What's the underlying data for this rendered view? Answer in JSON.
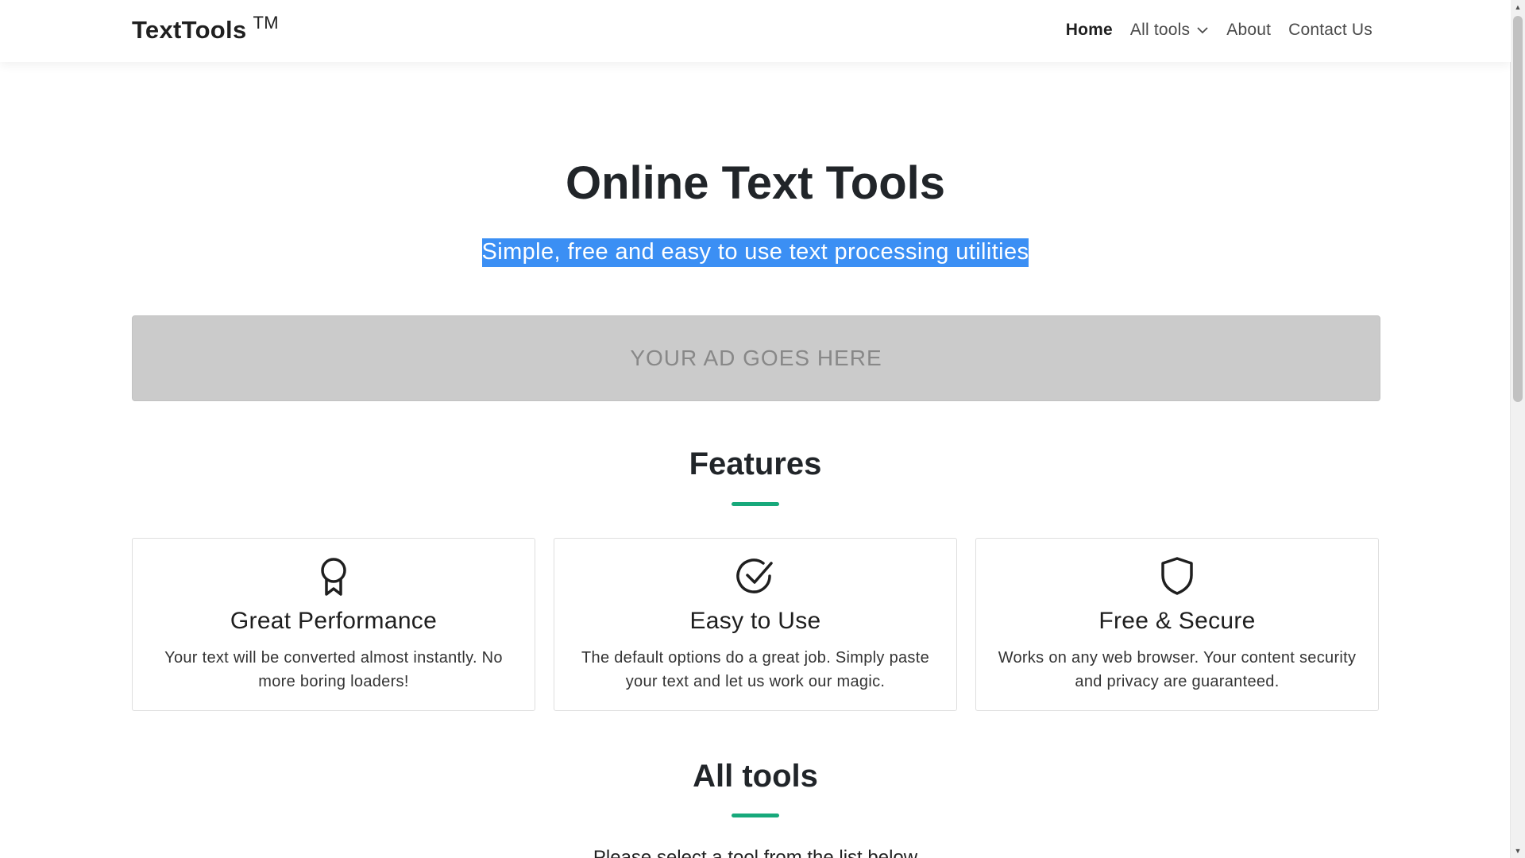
{
  "navbar": {
    "brand": "TextTools",
    "brand_mark": "TM",
    "links": [
      {
        "label": "Home",
        "active": true
      },
      {
        "label": "All tools",
        "dropdown": true
      },
      {
        "label": "About"
      },
      {
        "label": "Contact Us"
      }
    ]
  },
  "hero": {
    "title": "Online Text Tools",
    "subtitle": "Simple, free and easy to use text processing utilities"
  },
  "ad": {
    "label": "YOUR AD GOES HERE"
  },
  "features": {
    "title": "Features",
    "cards": [
      {
        "icon": "award-icon",
        "title": "Great Performance",
        "text": "Your text will be converted almost instantly. No more boring loaders!"
      },
      {
        "icon": "check-circle-icon",
        "title": "Easy to Use",
        "text": "The default options do a great job. Simply paste your text and let us work our magic."
      },
      {
        "icon": "shield-icon",
        "title": "Free & Secure",
        "text": "Works on any web browser. Your content security and privacy are guaranteed."
      }
    ]
  },
  "all_tools": {
    "title": "All tools",
    "partial_text": "Please select a tool from the list below"
  },
  "colors": {
    "accent": "#17a97b",
    "selection": "#3b8ff4",
    "ad_background": "#cbcbcb"
  }
}
